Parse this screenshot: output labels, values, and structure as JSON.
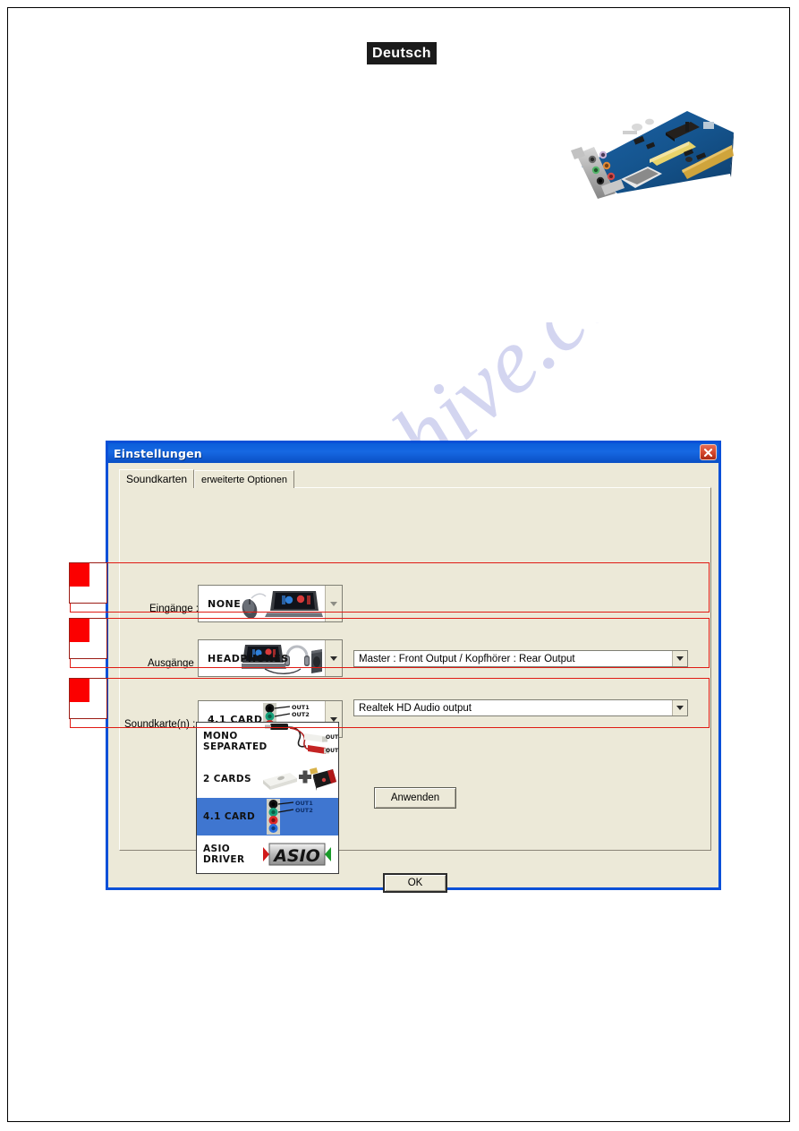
{
  "page": {
    "language_badge": "Deutsch",
    "watermark": "manualshive.com"
  },
  "illustration": {
    "soundcard_photo_alt": "pci-sound-card-photo"
  },
  "dialog": {
    "title": "Einstellungen",
    "close_label": "×",
    "tabs": [
      {
        "label": "Soundkarten",
        "active": true
      },
      {
        "label": "erweiterte Optionen",
        "active": false
      }
    ],
    "rows": [
      {
        "label": "Eingänge :",
        "combo_value": "NONE",
        "combo_art": "laptop-mouse"
      },
      {
        "label": "Ausgänge :",
        "combo_value": "HEADPHONES",
        "combo_art": "laptop-headphones-speaker",
        "detail_value": "Master : Front Output / Kopfhörer : Rear Output"
      },
      {
        "label": "Soundkarte(n) :",
        "combo_value": "4.1 CARD",
        "combo_art": "jack-panel",
        "detail_value": "Realtek HD Audio output"
      }
    ],
    "dropdown_options": [
      {
        "label": "MONO\nSEPARATED",
        "art": "mono-cable",
        "selected": false
      },
      {
        "label": "2 CARDS",
        "art": "two-cards",
        "selected": false
      },
      {
        "label": "4.1 CARD",
        "art": "jack-panel",
        "selected": true
      },
      {
        "label": "ASIO\nDRIVER",
        "art": "asio-logo",
        "selected": false
      }
    ],
    "jack_labels": {
      "out1": "OUT1",
      "out2": "OUT2"
    },
    "asio_logo_text": "ASIO",
    "apply_button": "Anwenden",
    "ok_button": "OK"
  },
  "colors": {
    "titlebar_blue": "#0b5ed9",
    "dialog_face": "#ece9d8",
    "annotation_red": "#e01b14",
    "marker_red": "#fb0000",
    "selection_blue": "#3f76d0"
  }
}
